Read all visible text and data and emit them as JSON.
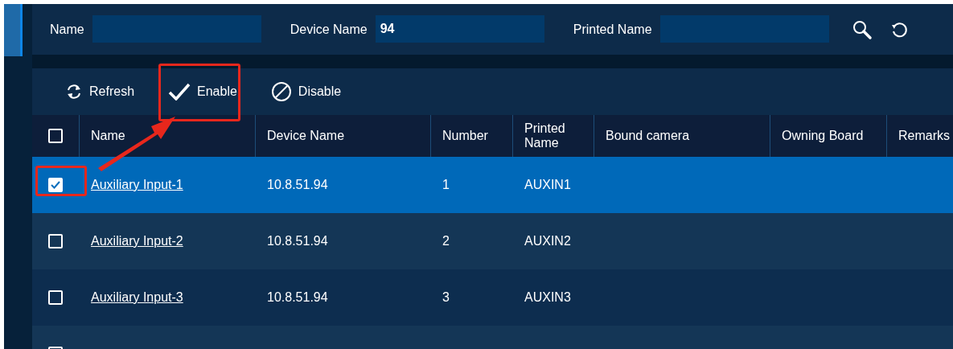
{
  "search": {
    "fields": [
      {
        "label": "Name"
      },
      {
        "label": "Device Name",
        "value": "94"
      },
      {
        "label": "Printed Name"
      }
    ]
  },
  "toolbar": [
    {
      "kind": "refresh",
      "label": "Refresh"
    },
    {
      "kind": "enable",
      "label": "Enable"
    },
    {
      "kind": "disable",
      "label": "Disable"
    }
  ],
  "table": {
    "header_checked": false,
    "columns": [
      "Name",
      "Device Name",
      "Number",
      "Printed Name",
      "Bound camera",
      "Owning Board",
      "Remarks"
    ],
    "rows": [
      {
        "selected": true,
        "checked": true,
        "cells": [
          "Auxiliary Input-1",
          "10.8.51.94",
          "1",
          "AUXIN1"
        ]
      },
      {
        "selected": false,
        "checked": false,
        "cells": [
          "Auxiliary Input-2",
          "10.8.51.94",
          "2",
          "AUXIN2"
        ]
      },
      {
        "selected": false,
        "checked": false,
        "cells": [
          "Auxiliary Input-3",
          "10.8.51.94",
          "3",
          "AUXIN3"
        ]
      },
      {
        "selected": false,
        "checked": false
      }
    ]
  }
}
